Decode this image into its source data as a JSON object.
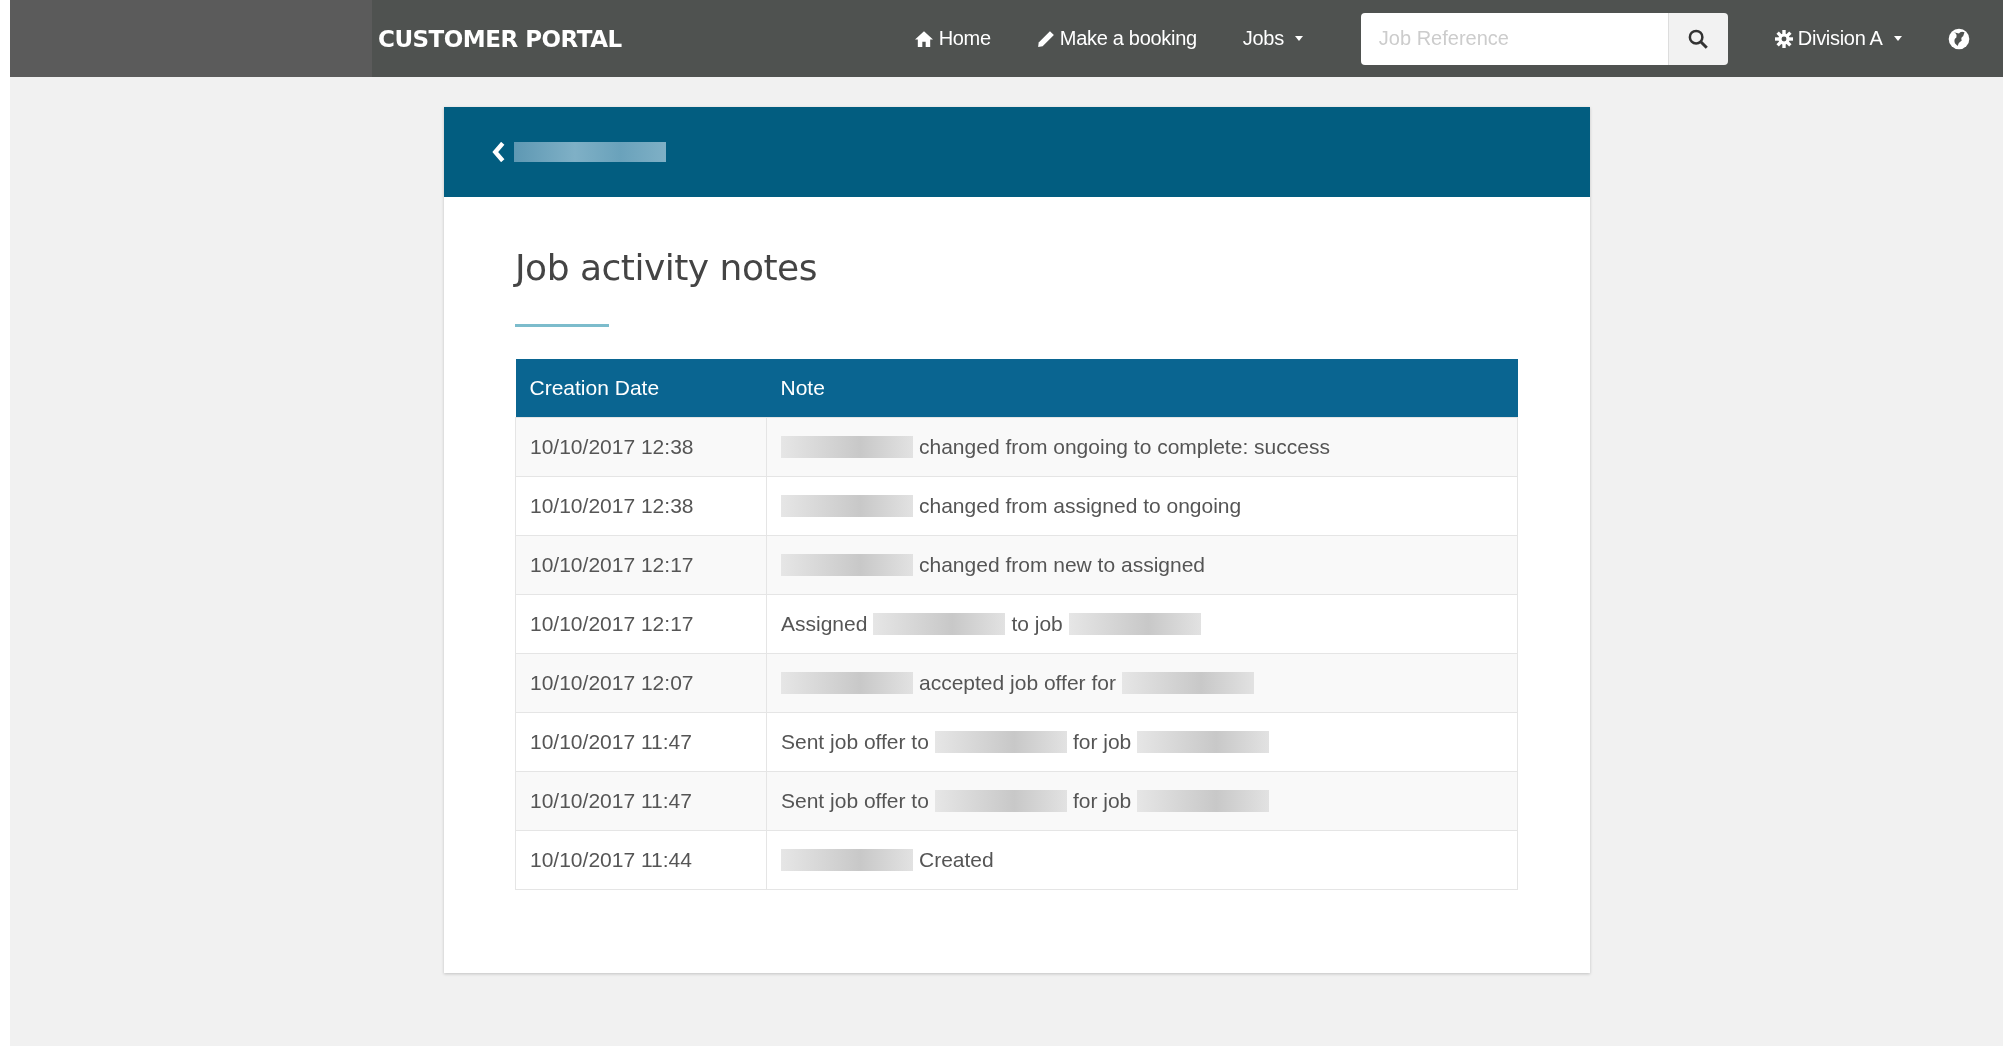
{
  "navbar": {
    "brand": "CUSTOMER PORTAL",
    "links": [
      {
        "label": "Home",
        "kind": "home",
        "dropdown": false
      },
      {
        "label": "Make a booking",
        "kind": "booking",
        "dropdown": false
      },
      {
        "label": "Jobs",
        "kind": "menu",
        "dropdown": true
      }
    ],
    "search": {
      "placeholder": "Job Reference"
    },
    "division": {
      "label": "Division A",
      "dropdown": true
    }
  },
  "card": {
    "back_link": {
      "kind": "redacted"
    },
    "title": "Job activity notes",
    "table": {
      "columns": [
        "Creation Date",
        "Note"
      ],
      "rows": [
        {
          "date": "10/10/2017 12:38",
          "note": [
            {
              "kind": "redacted"
            },
            {
              "kind": "text",
              "text": "changed from ongoing to complete: success"
            }
          ]
        },
        {
          "date": "10/10/2017 12:38",
          "note": [
            {
              "kind": "redacted"
            },
            {
              "kind": "text",
              "text": "changed from assigned to ongoing"
            }
          ]
        },
        {
          "date": "10/10/2017 12:17",
          "note": [
            {
              "kind": "redacted"
            },
            {
              "kind": "text",
              "text": "changed from new to assigned"
            }
          ]
        },
        {
          "date": "10/10/2017 12:17",
          "note": [
            {
              "kind": "text",
              "text": "Assigned"
            },
            {
              "kind": "redacted"
            },
            {
              "kind": "text",
              "text": "to job"
            },
            {
              "kind": "redacted"
            }
          ]
        },
        {
          "date": "10/10/2017 12:07",
          "note": [
            {
              "kind": "redacted"
            },
            {
              "kind": "text",
              "text": "accepted job offer for"
            },
            {
              "kind": "redacted"
            }
          ]
        },
        {
          "date": "10/10/2017 11:47",
          "note": [
            {
              "kind": "text",
              "text": "Sent job offer to"
            },
            {
              "kind": "redacted"
            },
            {
              "kind": "text",
              "text": "for job"
            },
            {
              "kind": "redacted"
            }
          ]
        },
        {
          "date": "10/10/2017 11:47",
          "note": [
            {
              "kind": "text",
              "text": "Sent job offer to"
            },
            {
              "kind": "redacted"
            },
            {
              "kind": "text",
              "text": "for job"
            },
            {
              "kind": "redacted"
            }
          ]
        },
        {
          "date": "10/10/2017 11:44",
          "note": [
            {
              "kind": "redacted"
            },
            {
              "kind": "text",
              "text": "Created"
            }
          ]
        }
      ]
    }
  }
}
